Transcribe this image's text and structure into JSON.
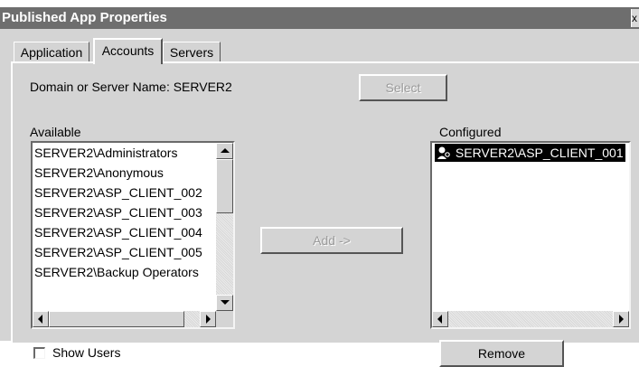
{
  "window": {
    "title": "Published App Properties",
    "close_glyph": "x"
  },
  "tabs": [
    {
      "label": "Application"
    },
    {
      "label": "Accounts"
    },
    {
      "label": "Servers"
    }
  ],
  "domain": {
    "label": "Domain or Server Name: SERVER2",
    "select_button": "Select"
  },
  "available": {
    "label": "Available",
    "items": [
      "SERVER2\\Administrators",
      "SERVER2\\Anonymous",
      "SERVER2\\ASP_CLIENT_002",
      "SERVER2\\ASP_CLIENT_003",
      "SERVER2\\ASP_CLIENT_004",
      "SERVER2\\ASP_CLIENT_005",
      "SERVER2\\Backup Operators"
    ]
  },
  "add_button": "Add ->",
  "configured": {
    "label": "Configured",
    "items": [
      {
        "text": "SERVER2\\ASP_CLIENT_001",
        "icon": "user-key-icon"
      }
    ]
  },
  "remove_button": "Remove",
  "show_users": {
    "label": "Show Users",
    "checked": false
  },
  "colors": {
    "titlebar": "#6e6e6e",
    "dialog_bg": "#d4d4d4",
    "selection": "#000000"
  }
}
